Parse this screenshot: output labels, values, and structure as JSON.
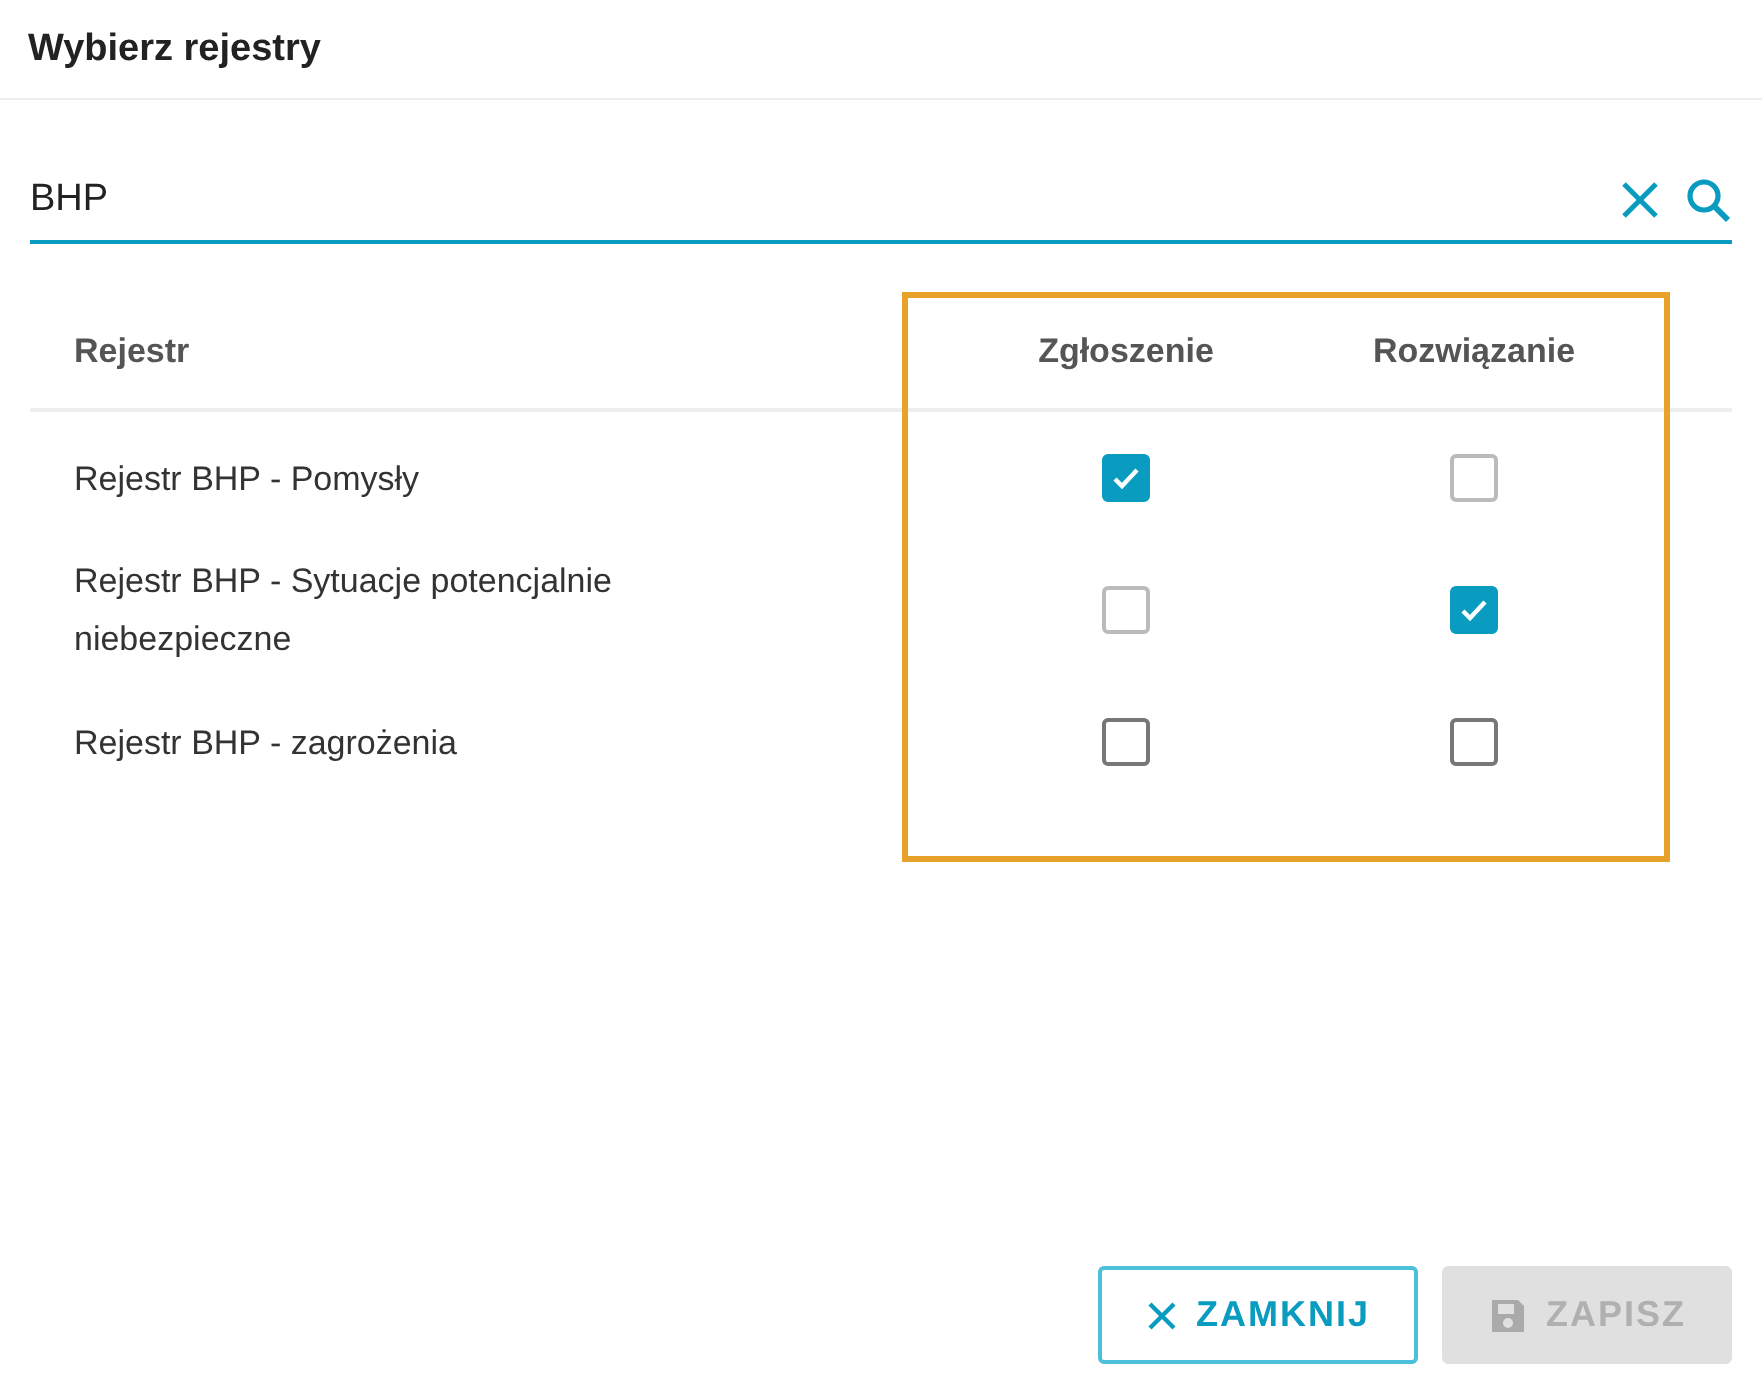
{
  "dialog": {
    "title": "Wybierz rejestry"
  },
  "search": {
    "value": "BHP"
  },
  "table": {
    "columns": [
      "Rejestr",
      "Zgłoszenie",
      "Rozwiązanie"
    ],
    "rows": [
      {
        "name": "Rejestr BHP - Pomysły",
        "checks": [
          {
            "checked": true,
            "disabled": false
          },
          {
            "checked": false,
            "disabled": true
          }
        ]
      },
      {
        "name": "Rejestr BHP - Sytuacje potencjalnie niebezpieczne",
        "checks": [
          {
            "checked": false,
            "disabled": true
          },
          {
            "checked": true,
            "disabled": false
          }
        ]
      },
      {
        "name": "Rejestr BHP - zagrożenia",
        "checks": [
          {
            "checked": false,
            "disabled": false
          },
          {
            "checked": false,
            "disabled": false
          }
        ]
      }
    ]
  },
  "buttons": [
    {
      "label": "ZAMKNIJ",
      "kind": "close",
      "disabled": false
    },
    {
      "label": "ZAPISZ",
      "kind": "save",
      "disabled": true
    }
  ]
}
